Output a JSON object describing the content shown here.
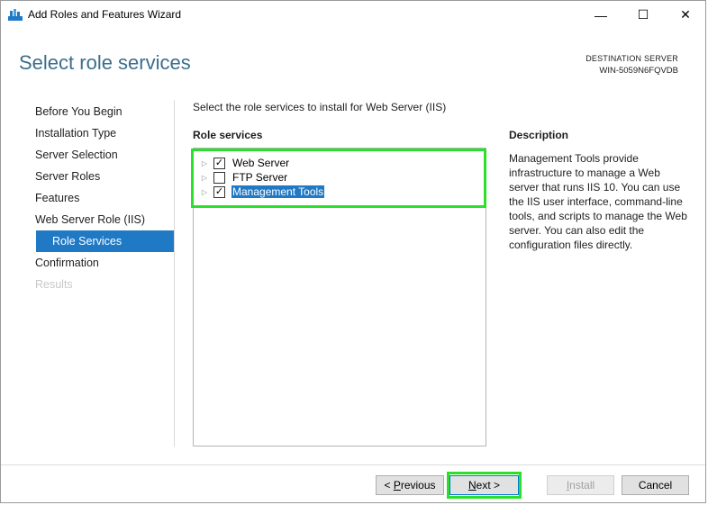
{
  "window": {
    "title": "Add Roles and Features Wizard",
    "minimize_glyph": "—",
    "maximize_glyph": "☐",
    "close_glyph": "✕"
  },
  "header": {
    "page_title": "Select role services",
    "destination_label": "DESTINATION SERVER",
    "destination_server": "WIN-5059N6FQVDB"
  },
  "nav": {
    "items": [
      {
        "label": "Before You Begin",
        "state": "normal"
      },
      {
        "label": "Installation Type",
        "state": "normal"
      },
      {
        "label": "Server Selection",
        "state": "normal"
      },
      {
        "label": "Server Roles",
        "state": "normal"
      },
      {
        "label": "Features",
        "state": "normal"
      },
      {
        "label": "Web Server Role (IIS)",
        "state": "normal"
      },
      {
        "label": "Role Services",
        "state": "active"
      },
      {
        "label": "Confirmation",
        "state": "normal"
      },
      {
        "label": "Results",
        "state": "disabled"
      }
    ]
  },
  "main": {
    "instruction": "Select the role services to install for Web Server (IIS)",
    "role_services_header": "Role services",
    "role_services": [
      {
        "label": "Web Server",
        "checked": true,
        "check_glyph": "✓",
        "expander_glyph": "▷",
        "selected": false
      },
      {
        "label": "FTP Server",
        "checked": false,
        "check_glyph": "",
        "expander_glyph": "▷",
        "selected": false
      },
      {
        "label": "Management Tools",
        "checked": true,
        "check_glyph": "✓",
        "expander_glyph": "▷",
        "selected": true
      }
    ],
    "description_header": "Description",
    "description_text": "Management Tools provide infrastructure to manage a Web server that runs IIS 10. You can use the IIS user interface, command-line tools, and scripts to manage the Web server. You can also edit the configuration files directly."
  },
  "footer": {
    "previous_prefix": "< ",
    "previous_accel": "P",
    "previous_rest": "revious",
    "next_accel": "N",
    "next_rest": "ext >",
    "install_accel": "I",
    "install_rest": "nstall",
    "cancel_label": "Cancel"
  },
  "colors": {
    "accent": "#1f79c5",
    "title_blue": "#3c6e8c",
    "highlight_green": "#2be02b"
  }
}
